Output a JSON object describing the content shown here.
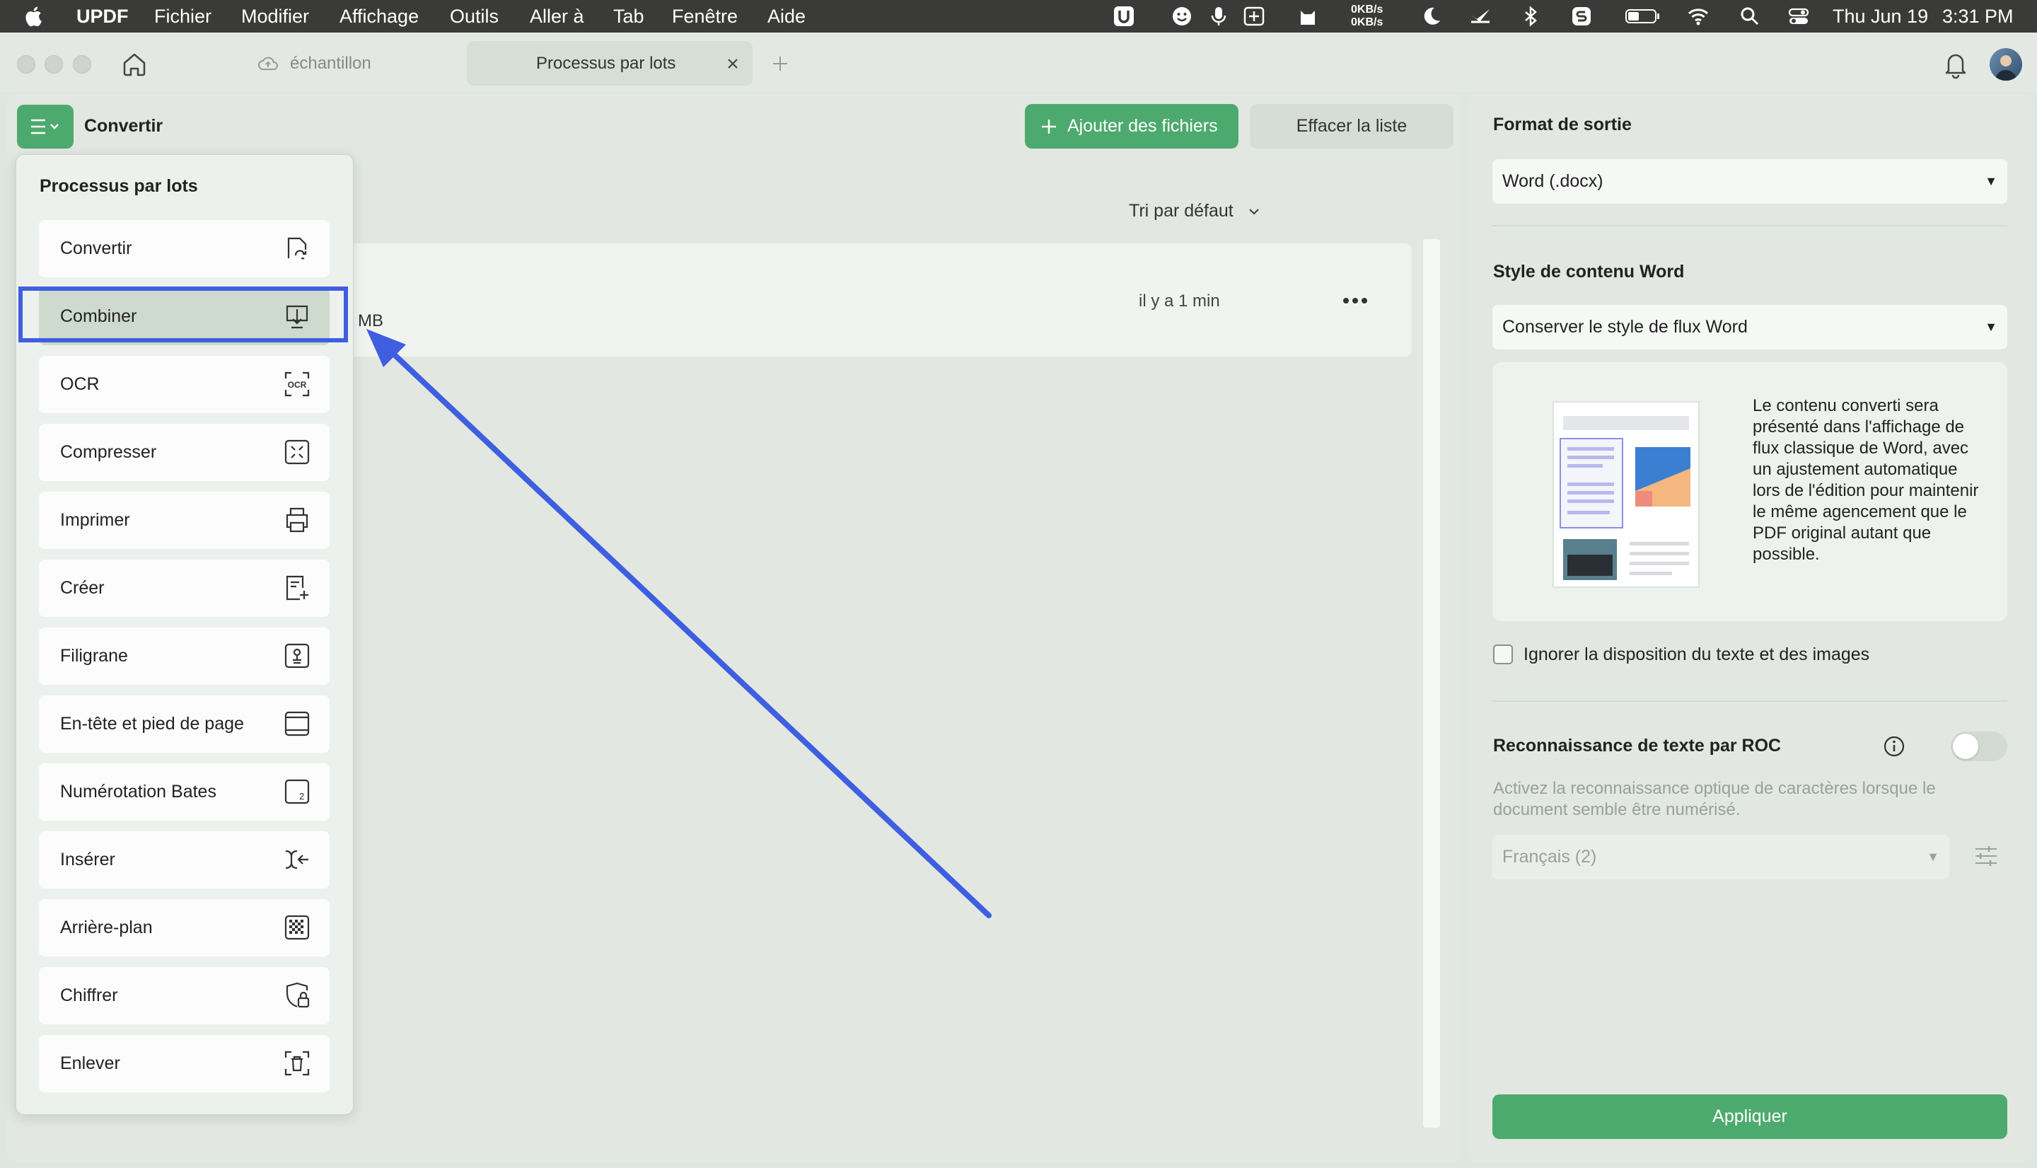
{
  "menubar": {
    "app": "UPDF",
    "items": [
      "Fichier",
      "Modifier",
      "Affichage",
      "Outils",
      "Aller à",
      "Tab",
      "Fenêtre",
      "Aide"
    ],
    "net_up": "0KB/s",
    "net_down": "0KB/s",
    "date": "Thu Jun 19",
    "time": "3:31 PM"
  },
  "tabs": {
    "tab1": "échantillon",
    "tab2": "Processus par lots"
  },
  "toolbar": {
    "current_tool": "Convertir",
    "add_files": "Ajouter des fichiers",
    "clear_list": "Effacer la liste",
    "sort": "Tri par défaut"
  },
  "file_row": {
    "size_suffix": "MB",
    "time": "il y a 1 min"
  },
  "batch_menu": {
    "title": "Processus par lots",
    "items": [
      {
        "label": "Convertir",
        "icon": "convert-icon"
      },
      {
        "label": "Combiner",
        "icon": "combine-icon"
      },
      {
        "label": "OCR",
        "icon": "ocr-icon"
      },
      {
        "label": "Compresser",
        "icon": "compress-icon"
      },
      {
        "label": "Imprimer",
        "icon": "printer-icon"
      },
      {
        "label": "Créer",
        "icon": "create-icon"
      },
      {
        "label": "Filigrane",
        "icon": "watermark-icon"
      },
      {
        "label": "En-tête et pied de page",
        "icon": "header-footer-icon"
      },
      {
        "label": "Numérotation Bates",
        "icon": "bates-icon"
      },
      {
        "label": "Insérer",
        "icon": "insert-icon"
      },
      {
        "label": "Arrière-plan",
        "icon": "background-icon"
      },
      {
        "label": "Chiffrer",
        "icon": "encrypt-icon"
      },
      {
        "label": "Enlever",
        "icon": "remove-icon"
      }
    ],
    "highlighted": "Combiner"
  },
  "right_panel": {
    "output_format_label": "Format de sortie",
    "output_format_value": "Word (.docx)",
    "word_style_label": "Style de contenu Word",
    "word_style_value": "Conserver le style de flux Word",
    "description": "Le contenu converti sera présenté dans l'affichage de flux classique de Word, avec un ajustement automatique lors de l'édition pour maintenir le même agencement que le PDF original autant que possible.",
    "ignore_layout": "Ignorer la disposition du texte et des images",
    "ocr_label": "Reconnaissance de texte par ROC",
    "ocr_desc": "Activez la reconnaissance optique de caractères lorsque le document semble être numérisé.",
    "ocr_language": "Français (2)",
    "apply": "Appliquer"
  },
  "colors": {
    "accent_green": "#4daa6e",
    "highlight_blue": "#3f5ee0",
    "menubar": "#3a3b38"
  }
}
